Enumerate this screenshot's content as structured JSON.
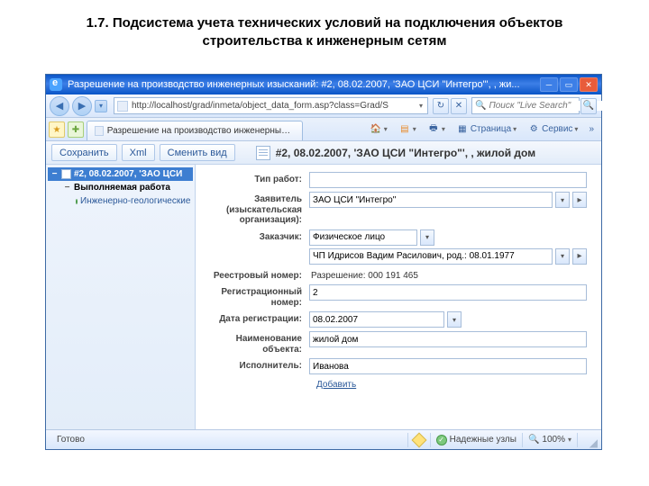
{
  "slide": {
    "title": "1.7. Подсистема учета технических условий на подключения объектов строительства к инженерным сетям"
  },
  "window": {
    "title": "Разрешение на производство инженерных изысканий: #2, 08.02.2007, 'ЗАО ЦСИ \"Интегро\"', , жи..."
  },
  "nav": {
    "url": "http://localhost/grad/inmeta/object_data_form.asp?class=Grad/S",
    "search_placeholder": "Поиск \"Live Search\""
  },
  "tabs": {
    "active": "Разрешение на производство инженерных изыска..."
  },
  "toolbar_ie": {
    "page": "Страница",
    "service": "Сервис"
  },
  "app_toolbar": {
    "save": "Сохранить",
    "xml": "Xml",
    "change_view": "Сменить вид",
    "doc_title": "#2, 08.02.2007, 'ЗАО ЦСИ \"Интегро\"', , жилой дом"
  },
  "tree": {
    "root": "#2, 08.02.2007, 'ЗАО ЦСИ",
    "child": "Выполняемая работа",
    "leaf": "Инженерно-геологические",
    "add": "Добавить"
  },
  "form": {
    "labels": {
      "work_type": "Тип работ:",
      "applicant": "Заявитель (изыскательская организация):",
      "customer": "Заказчик:",
      "registry_no": "Реестровый номер:",
      "reg_no": "Регистрационный номер:",
      "reg_date": "Дата регистрации:",
      "obj_name": "Наименование объекта:",
      "executor": "Исполнитель:"
    },
    "values": {
      "work_type": "",
      "applicant": "ЗАО ЦСИ \"Интегро\"",
      "customer_type": "Физическое лицо",
      "customer": "ЧП Идрисов Вадим Расилович, род.: 08.01.1977",
      "registry_no_text": "Разрешение: 000 191 465",
      "reg_no": "2",
      "reg_date": "08.02.2007",
      "obj_name": "жилой дом",
      "executor": "Иванова"
    },
    "add_link": "Добавить"
  },
  "status": {
    "ready": "Готово",
    "trusted": "Надежные узлы",
    "zoom": "100%"
  }
}
